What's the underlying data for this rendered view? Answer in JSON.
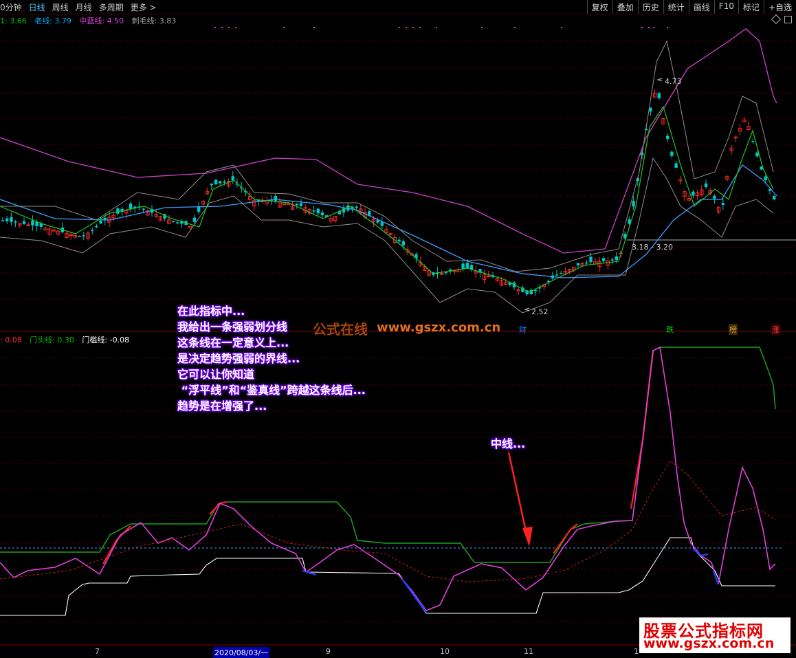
{
  "toolbar": {
    "period_label": "0分钟",
    "tabs": [
      "日线",
      "周线",
      "月线",
      "多周期",
      "更多 >"
    ],
    "right_buttons": [
      "复权",
      "叠加",
      "历史",
      "统计",
      "画线",
      "F10",
      "标记",
      "+自选"
    ]
  },
  "top_legend": {
    "item0": "1: 3.66",
    "item1": "老线: 3.79",
    "item2": "中蓝线: 4.50",
    "item3": "刺毛线: 3.83",
    "colors": {
      "item0": "#00c000",
      "item1": "#00a8ff",
      "item2": "#e040e0",
      "item3": "#a0a0a0"
    }
  },
  "bottom_legend": {
    "item0": ": 0.08",
    "item1": "门头线: 0.30",
    "item2": "门槛线: -0.08",
    "colors": {
      "item0": "#ff3030",
      "item1": "#00c000",
      "item2": "#ffffff"
    }
  },
  "price_annotations": {
    "high": "4.73",
    "low": "2.52",
    "range": "3.18 - 3.20"
  },
  "event_markers": {
    "m1": "财",
    "m2": "跌",
    "m3": "榜",
    "m4": "涨"
  },
  "notes": {
    "main": "在此指标中...\n我给出一条强弱划分线\n这条线在一定意义上...\n是决定趋势强弱的界线...\n它可以让你知道\n “浮平线”和“鉴真线”跨越这条线后...\n趋势是在增强了...",
    "midline": "中线..."
  },
  "watermarks": {
    "center_cn": "公式在线",
    "center_url": "www.gszx.com.cn",
    "brand_cn": "股票公式指标网",
    "brand_url": "www.gszx.com.cn"
  },
  "date_axis": {
    "d1": "7",
    "d2": "2020/08/03/一",
    "d3": "9",
    "d4": "10",
    "d5": "11",
    "d6": "1"
  }
}
